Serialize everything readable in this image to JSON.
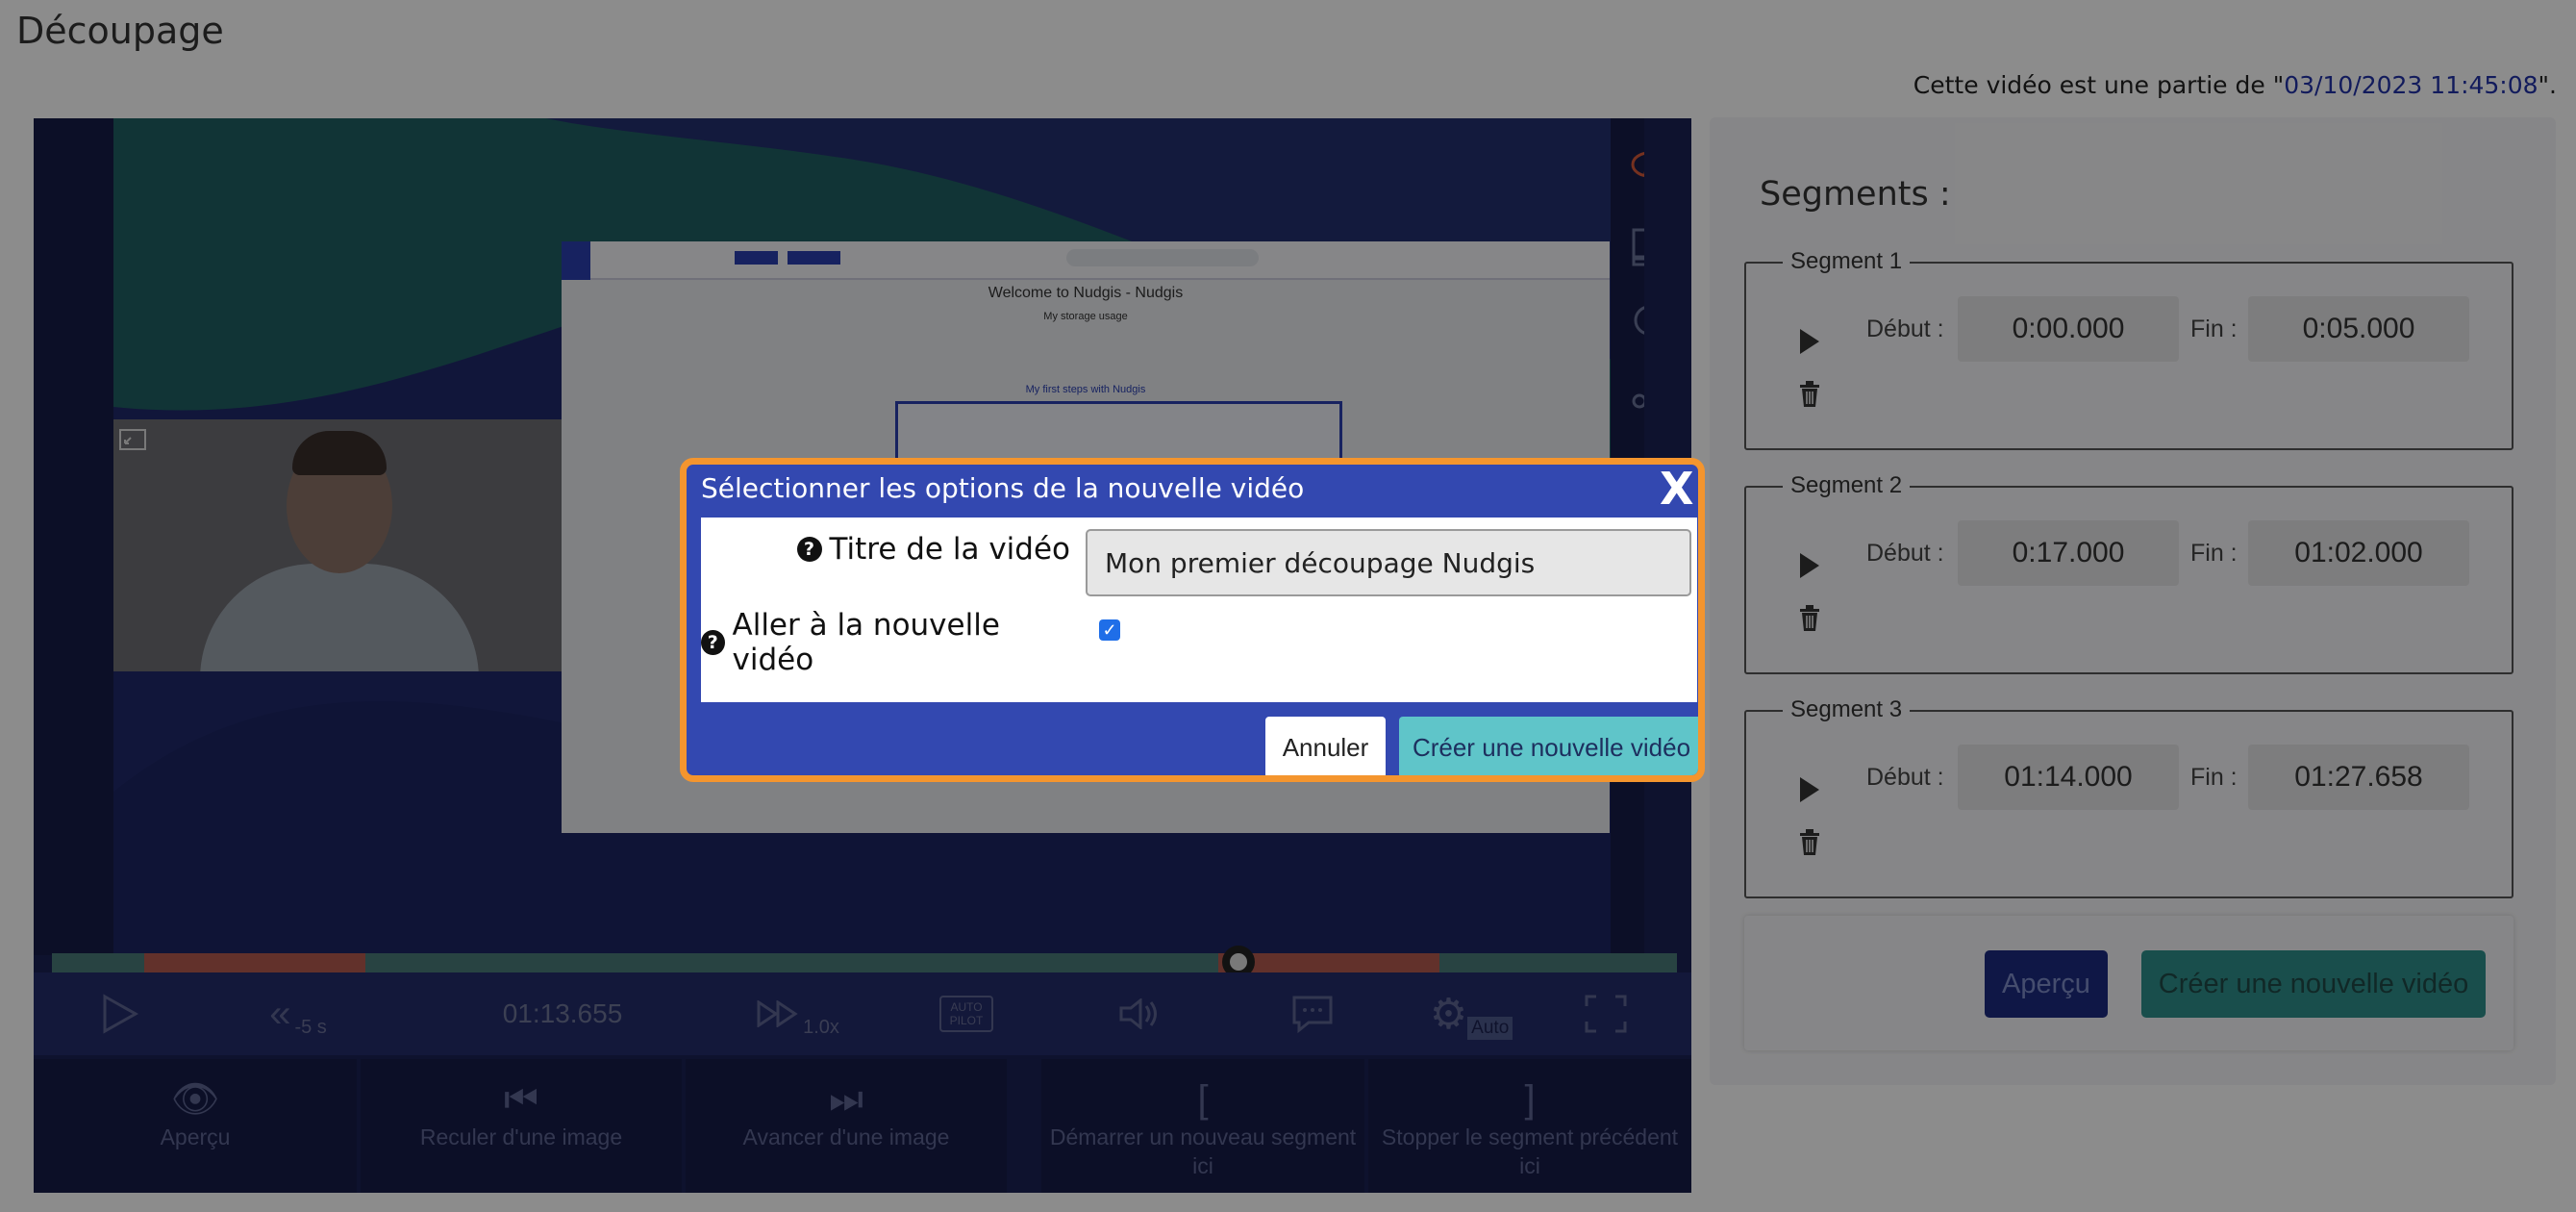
{
  "page": {
    "title": "Découpage",
    "part_of_prefix": "Cette vidéo est une partie de \"",
    "part_of_link": "03/10/2023 11:45:08",
    "part_of_suffix": "\"."
  },
  "player": {
    "screen_title": "Welcome to Nudgis - Nudgis",
    "screen_subtitle": "My storage usage",
    "screen_section": "My first steps with Nudgis",
    "controls": {
      "rewind_label": "-5 s",
      "time": "01:13.655",
      "speed": "1.0x",
      "autopilot_label": "AUTO PILOT",
      "quality_badge": "Auto"
    },
    "progress": {
      "position_fraction": 0.73
    },
    "actions": [
      {
        "label": "Aperçu"
      },
      {
        "label": "Reculer d'une image"
      },
      {
        "label": "Avancer d'une image"
      },
      {
        "label": "Démarrer un nouveau segment ici"
      },
      {
        "label": "Stopper le segment précédent ici"
      }
    ]
  },
  "segments_panel": {
    "title": "Segments :",
    "start_label": "Début :",
    "end_label": "Fin :",
    "segments": [
      {
        "name": "Segment 1",
        "start": "0:00.000",
        "end": "0:05.000"
      },
      {
        "name": "Segment 2",
        "start": "0:17.000",
        "end": "01:02.000"
      },
      {
        "name": "Segment 3",
        "start": "01:14.000",
        "end": "01:27.658"
      }
    ],
    "preview_button": "Aperçu",
    "create_button": "Créer une nouvelle vidéo"
  },
  "modal": {
    "title": "Sélectionner les options de la nouvelle vidéo",
    "close": "X",
    "title_field_label": "Titre de la vidéo",
    "title_field_value": "Mon premier découpage Nudgis",
    "goto_label": "Aller à la nouvelle vidéo",
    "goto_checked": true,
    "cancel_button": "Annuler",
    "confirm_button": "Créer une nouvelle vidéo"
  },
  "colors": {
    "accent_orange": "#f4952e",
    "modal_blue": "#3348b0",
    "confirm_teal": "#5fc5c9"
  }
}
